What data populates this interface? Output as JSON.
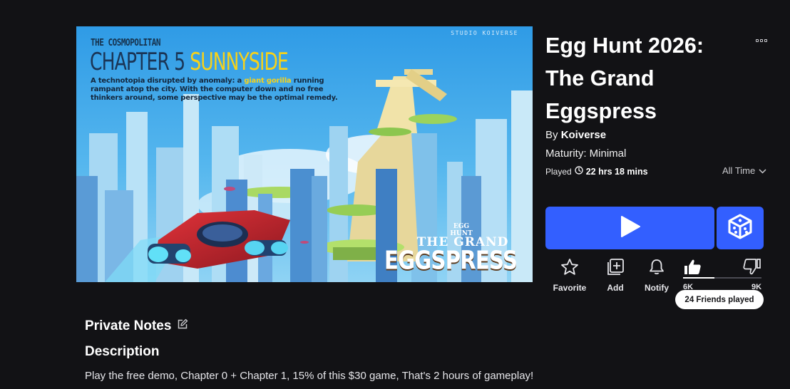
{
  "thumbnail": {
    "publication": "THE COSMOPOLITAN",
    "chapter_prefix": "CHAPTER 5",
    "chapter_name": "SUNNYSIDE",
    "studio_mark": "STUDIO KOIVERSE",
    "blurb_before": "A technotopia disrupted by anomaly: a ",
    "blurb_highlight": "giant gorilla",
    "blurb_after": " running rampant atop the city. With the computer down and no free thinkers around, some perspective may be the optimal remedy.",
    "logo_small": "EGG HUNT",
    "logo_mid": "THE GRAND",
    "logo_big": "EGGSPRESS"
  },
  "game": {
    "title": "Egg Hunt 2026: The Grand Eggspress",
    "by_prefix": "By",
    "creator": "Koiverse",
    "maturity": "Maturity: Minimal",
    "played_label": "Played",
    "played_duration": "22 hrs 18 mins",
    "time_filter": "All Time"
  },
  "actions": {
    "favorite": "Favorite",
    "add": "Add",
    "notify": "Notify"
  },
  "votes": {
    "up": "6K",
    "down": "9K",
    "up_fraction": 0.4
  },
  "friends_played": "24 Friends played",
  "sections": {
    "private_notes": "Private Notes",
    "description_heading": "Description",
    "description_text": "Play the free demo, Chapter 0 + Chapter 1, 15% of this $30 game, That's 2 hours of gameplay!"
  },
  "colors": {
    "background": "#121215",
    "accent": "#335fff",
    "text": "#ffffff"
  }
}
